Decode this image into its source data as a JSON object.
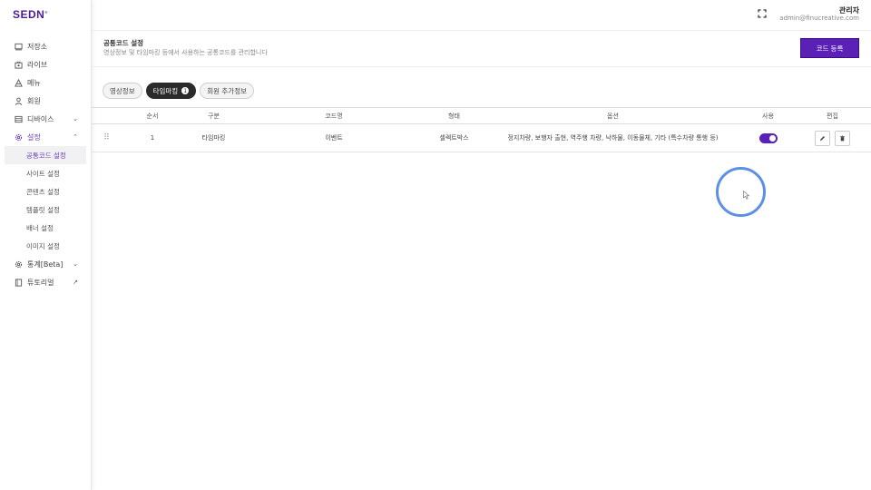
{
  "app": {
    "logo": "SEDN",
    "logo_mark": "®"
  },
  "sidebar": {
    "items": [
      {
        "label": "저장소",
        "icon": "storage-icon"
      },
      {
        "label": "라이브",
        "icon": "live-icon"
      },
      {
        "label": "메뉴",
        "icon": "menu-icon"
      },
      {
        "label": "회원",
        "icon": "user-icon"
      },
      {
        "label": "디바이스",
        "icon": "device-icon",
        "chevron": "⌄"
      },
      {
        "label": "설정",
        "icon": "gear-icon",
        "chevron": "⌃",
        "active": true
      },
      {
        "label": "통계[Beta]",
        "icon": "stats-icon",
        "chevron": "⌄"
      },
      {
        "label": "튜토리얼",
        "icon": "tutorial-icon",
        "chevron": "↗"
      }
    ],
    "settings_sub": [
      "공통코드 설정",
      "사이트 설정",
      "콘텐츠 설정",
      "템플릿 설정",
      "배너 설정",
      "이미지 설정"
    ]
  },
  "topbar": {
    "user_name": "관리자",
    "user_email": "admin@finucreative.com"
  },
  "header": {
    "title": "공통코드 설정",
    "description": "영상정보 및 타임마킹 등에서 사용하는 공통코드를 관리합니다",
    "add_button": "코드 등록"
  },
  "tabs": [
    {
      "label": "영상정보"
    },
    {
      "label": "타임마킹",
      "badge": "1",
      "active": true
    },
    {
      "label": "회원 추가정보"
    }
  ],
  "table": {
    "columns": [
      "순서",
      "구분",
      "코드명",
      "형태",
      "옵션",
      "사용",
      "편집"
    ],
    "rows": [
      {
        "order": "1",
        "type": "타임마킹",
        "name": "이벤트",
        "form": "셀렉트박스",
        "options": "정지차량, 보행자 출현, 역주행 차량, 낙하물, 이동물체, 기타 (특수차량 통행 등)",
        "enabled": true
      }
    ]
  },
  "colors": {
    "accent": "#5b21b6",
    "cursor_ring": "#5d8fe6"
  }
}
